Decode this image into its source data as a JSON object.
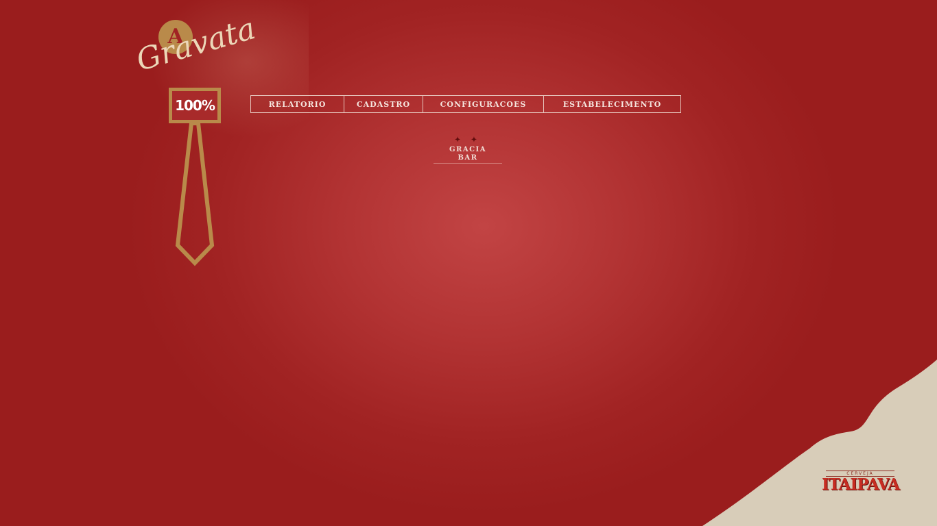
{
  "logo": {
    "initial": "A",
    "script": "Gravata",
    "percent": "100%",
    "colors": {
      "gold": "#b98a4a",
      "cream": "#ecd7b8"
    }
  },
  "nav": {
    "items": [
      {
        "label": "RELATORIO"
      },
      {
        "label": "CADASTRO"
      },
      {
        "label": "CONFIGURACOES"
      },
      {
        "label": "ESTABELECIMENTO"
      }
    ]
  },
  "establishment": {
    "stars": "✦ ✦",
    "line1": "GRACIA",
    "line2": "BAR"
  },
  "sponsor": {
    "small": "CERVEJA",
    "name": "ITAIPAVA"
  },
  "colors": {
    "background": "#a12323",
    "corner": "#d8cdb9"
  }
}
